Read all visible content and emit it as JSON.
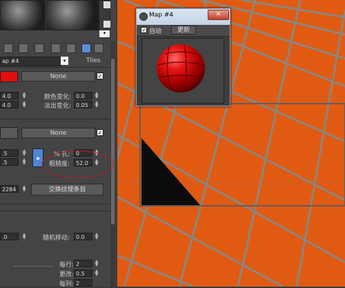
{
  "panel": {
    "map_name": "ap #4",
    "tiles_label": "Tiles",
    "row1": {
      "color_hex": "#e1100f",
      "none_label": "None"
    },
    "row2": {
      "val_a": "4.0",
      "val_b": "4.0",
      "color_variance_label": "颜色变化:",
      "color_variance_value": "0.0",
      "fade_variance_label": "淡出变化:",
      "fade_variance_value": "0.05"
    },
    "row3": {
      "none_label": "None"
    },
    "row4": {
      "val_a": ".5",
      "val_b": ".5",
      "holes_label": "% 孔:",
      "holes_value": "0",
      "roughness_label": "粗糙度:",
      "roughness_value": "52.0"
    },
    "row5": {
      "seed_value": "2284",
      "swap_button_label": "交换纹理条目"
    },
    "row6": {
      "random_shift_label": "随机移动:",
      "random_shift_value": "0.0",
      "val_a": ".0"
    },
    "row7": {
      "per_row_label": "每行:",
      "per_row_value": "2",
      "change_label": "更改:",
      "change_value": "0.5",
      "per_col_label": "每列:",
      "per_col_value": "2"
    }
  },
  "dialog": {
    "title": "Map #4",
    "close_label": "✕",
    "auto_label": "自动",
    "update_label": "更新"
  },
  "colors": {
    "viewport_orange": "#e15a12",
    "grout_gray": "#8a8680",
    "accent_blue": "#5b8ed6"
  }
}
